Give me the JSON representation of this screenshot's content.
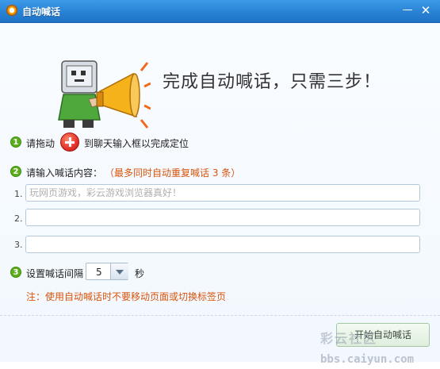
{
  "window": {
    "title": "自动喊话",
    "min_symbol": "—",
    "close_symbol": "✕"
  },
  "header": {
    "headline": "完成自动喊话，只需三步！"
  },
  "step1": {
    "number": "1",
    "label_before": "请拖动",
    "label_after": "到聊天输入框以完成定位"
  },
  "step2": {
    "number": "2",
    "label": "请输入喊话内容：",
    "hint": "（最多同时自动重复喊话 3 条）",
    "rows": [
      {
        "index": "1.",
        "value": "",
        "placeholder": "玩网页游戏，彩云游戏浏览器真好！"
      },
      {
        "index": "2.",
        "value": "",
        "placeholder": ""
      },
      {
        "index": "3.",
        "value": "",
        "placeholder": ""
      }
    ]
  },
  "step3": {
    "number": "3",
    "label": "设置喊话间隔",
    "interval_value": "5",
    "unit": "秒",
    "note": "注：使用自动喊话时不要移动页面或切换标签页"
  },
  "footer": {
    "start_label": "开始自动喊话"
  },
  "watermark": {
    "text": "彩云社区",
    "url": "bbs.caiyun.com"
  },
  "icons": {
    "app": "app-logo-icon",
    "mascot": "megaphone-mascot-icon",
    "drag_target": "crosshair-drag-icon",
    "dropdown": "chevron-down-icon"
  },
  "colors": {
    "titlebar": "#2a84d6",
    "step_badge": "#5cae1c",
    "hint": "#d9540d",
    "drag_target": "#e4322b"
  }
}
